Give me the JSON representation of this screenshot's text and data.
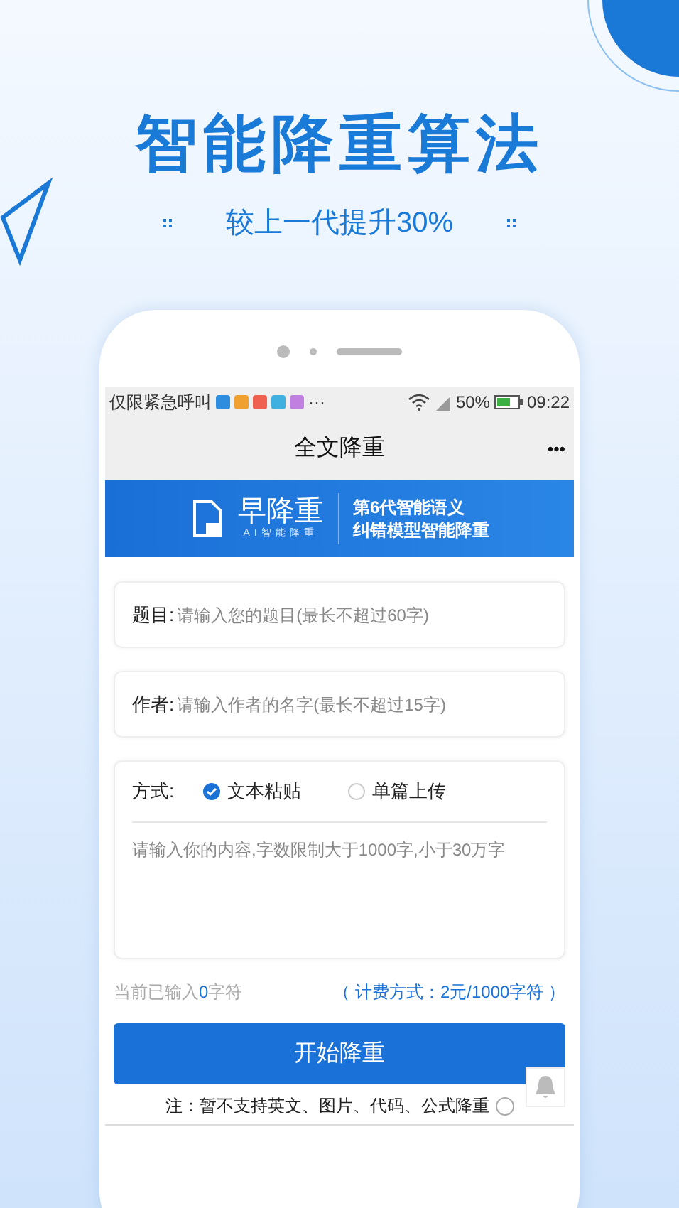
{
  "headline": "智能降重算法",
  "subtitle": "较上一代提升30%",
  "status_bar": {
    "carrier": "仅限紧急呼叫",
    "more": "···",
    "battery": "50%",
    "time": "09:22"
  },
  "nav": {
    "title": "全文降重",
    "menu": "•••"
  },
  "banner": {
    "logo_text": "早降重",
    "logo_sub": "AI智能降重",
    "slogan_lines": [
      "第6代智能语义",
      "纠错模型智能降重"
    ]
  },
  "fields": [
    {
      "label": "题目:",
      "placeholder": "请输入您的题目(最长不超过60字)"
    },
    {
      "label": "作者:",
      "placeholder": "请输入作者的名字(最长不超过15字)"
    }
  ],
  "mode": {
    "label": "方式:",
    "options": [
      {
        "label": "文本粘贴",
        "selected": true
      },
      {
        "label": "单篇上传",
        "selected": false
      }
    ],
    "placeholder": "请输入你的内容,字数限制大于1000字,小于30万字"
  },
  "counter": {
    "prefix": "当前已输入",
    "count": "0",
    "suffix": "字符"
  },
  "pricing": "（ 计费方式：2元/1000字符 ）",
  "submit": "开始降重",
  "note": "注：暂不支持英文、图片、代码、公式降重"
}
